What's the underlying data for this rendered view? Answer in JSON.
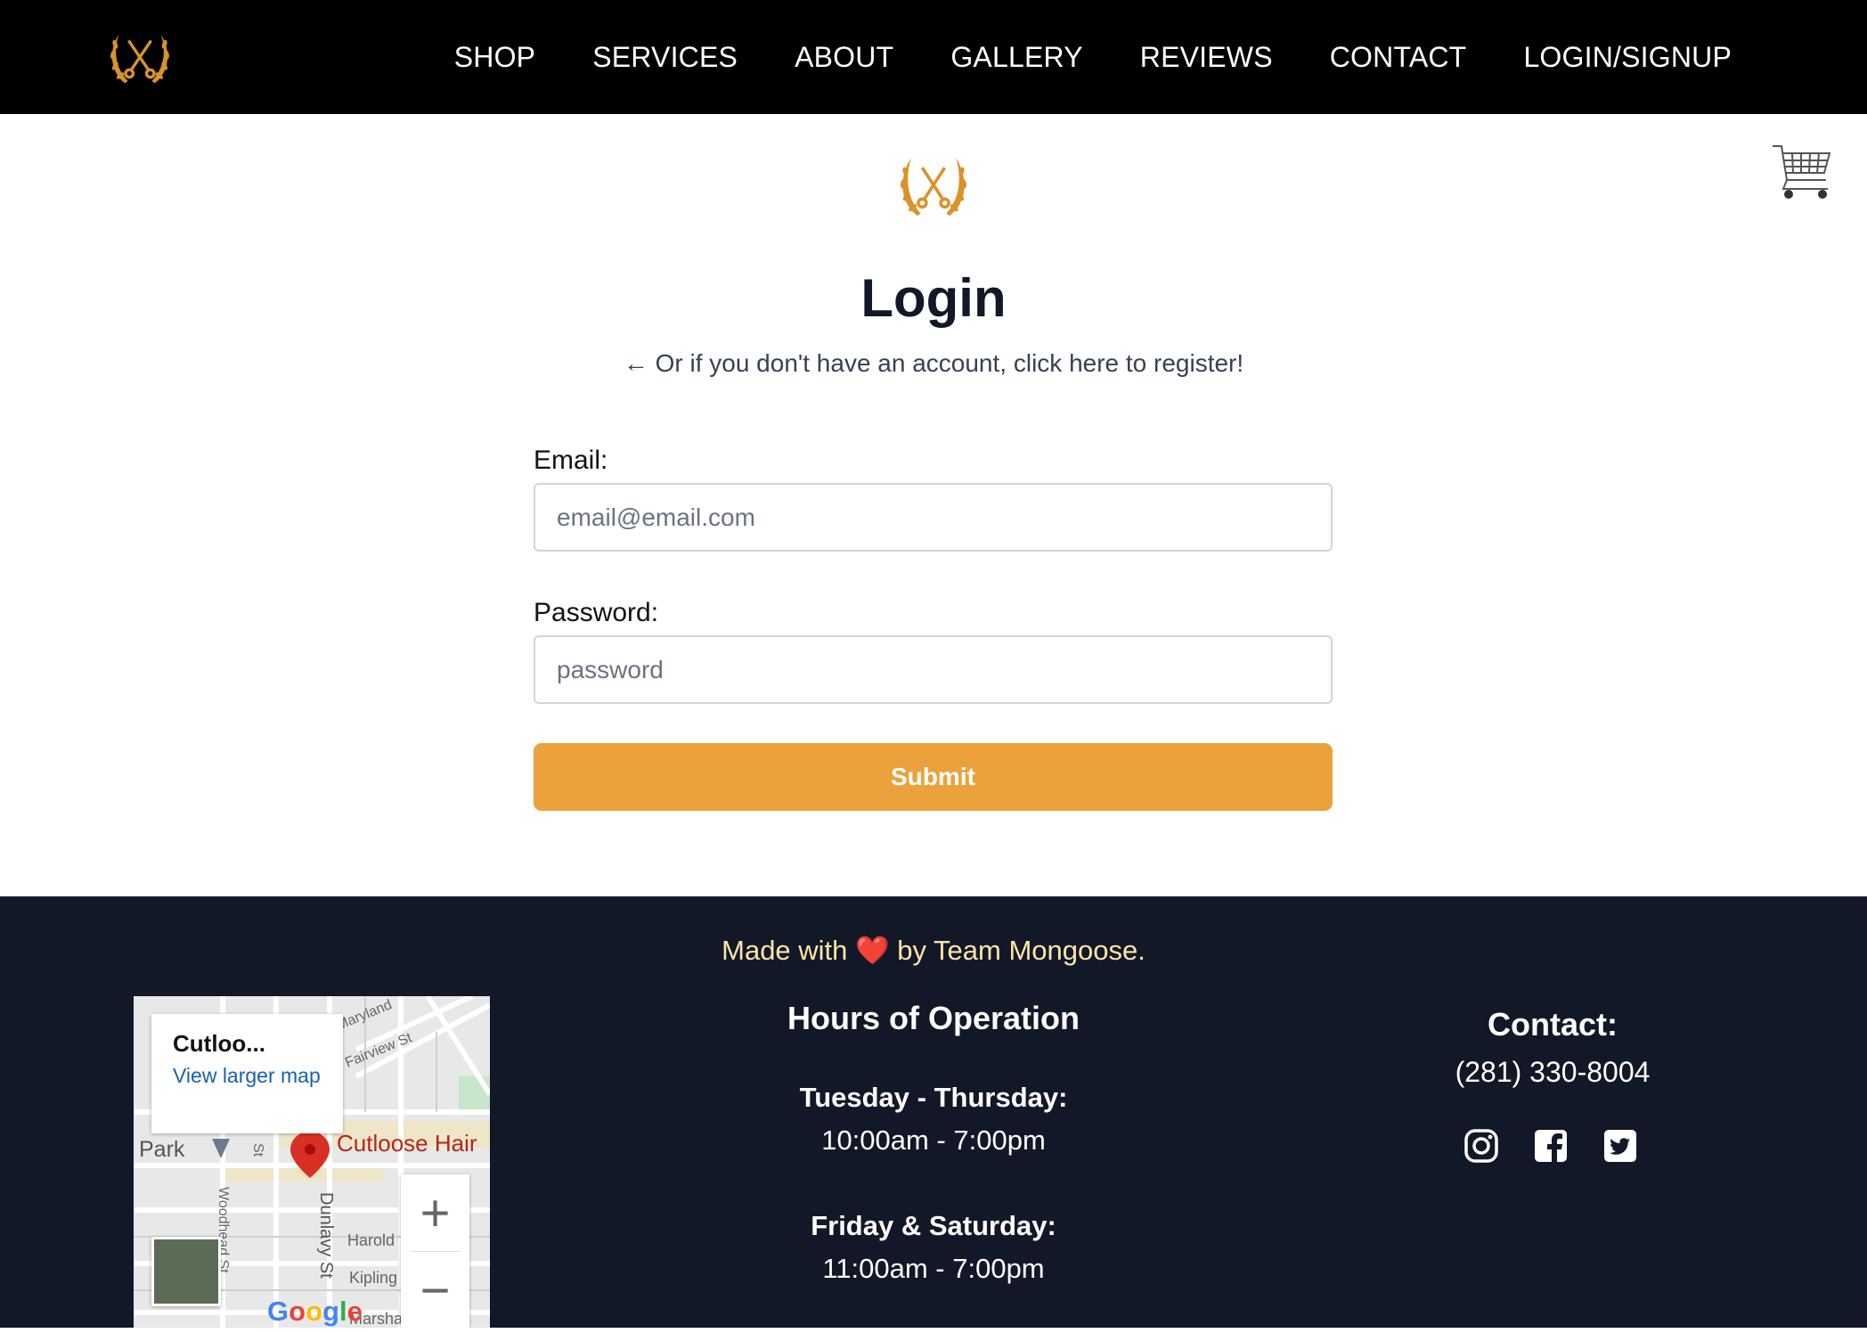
{
  "nav": {
    "links": [
      "SHOP",
      "SERVICES",
      "ABOUT",
      "GALLERY",
      "REVIEWS",
      "CONTACT",
      "LOGIN/SIGNUP"
    ]
  },
  "login": {
    "title": "Login",
    "register_text": "← Or if you don't have an account, click here to register!",
    "email_label": "Email:",
    "email_placeholder": "email@email.com",
    "password_label": "Password:",
    "password_placeholder": "password",
    "submit_label": "Submit"
  },
  "footer": {
    "made_with_prefix": "Made with ",
    "heart": "❤️",
    "made_with_suffix": " by Team Mongoose.",
    "map": {
      "card_title": "Cutloo...",
      "card_link": "View larger map",
      "place_label": "Cutloose Hair",
      "google": "Google",
      "streets": [
        "Maryland",
        "Fairview St",
        "Park",
        "Woodhead St",
        "Dunlavy St",
        "Harold",
        "Kipling",
        "Marshall St",
        "St"
      ]
    },
    "hours": {
      "title": "Hours of Operation",
      "entries": [
        {
          "day": "Tuesday - Thursday:",
          "time": "10:00am - 7:00pm"
        },
        {
          "day": "Friday & Saturday:",
          "time": "11:00am - 7:00pm"
        }
      ]
    },
    "contact": {
      "title": "Contact:",
      "phone": "(281) 330-8004",
      "social": [
        "instagram-icon",
        "facebook-icon",
        "twitter-icon"
      ]
    }
  },
  "colors": {
    "nav_bg": "#000000",
    "gold": "#eba23c",
    "footer_bg": "#121827",
    "footer_accent": "#fde5a7"
  }
}
